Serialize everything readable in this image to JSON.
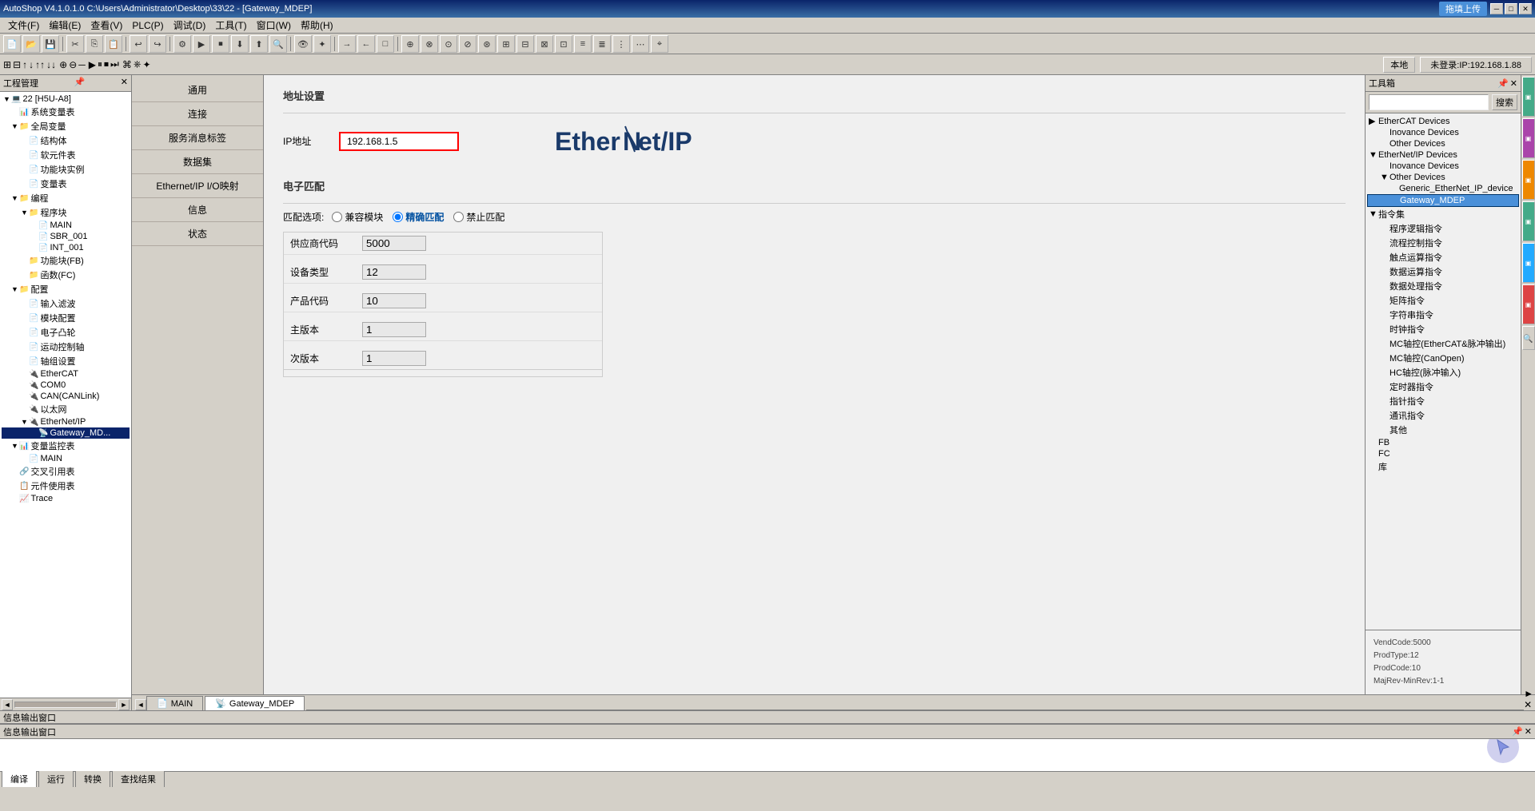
{
  "window": {
    "title": "AutoShop V4.1.0.1.0  C:\\Users\\Administrator\\Desktop\\33\\22 - [Gateway_MDEP]",
    "upload_btn": "拖填上传"
  },
  "menu": {
    "items": [
      "文件(F)",
      "编辑(E)",
      "查看(V)",
      "PLC(P)",
      "调试(D)",
      "工具(T)",
      "窗口(W)",
      "帮助(H)"
    ]
  },
  "toolbar2": {
    "location_btn": "本地",
    "ip_btn": "未登录:IP:192.168.1.88"
  },
  "project_tree": {
    "header": "工程管理",
    "items": [
      {
        "label": "22 [H5U-A8]",
        "indent": 0,
        "expanded": true
      },
      {
        "label": "系统变量表",
        "indent": 1
      },
      {
        "label": "全局变量",
        "indent": 1,
        "expanded": true
      },
      {
        "label": "结构体",
        "indent": 2
      },
      {
        "label": "软元件表",
        "indent": 2
      },
      {
        "label": "功能块实例",
        "indent": 2
      },
      {
        "label": "变量表",
        "indent": 2
      },
      {
        "label": "编程",
        "indent": 1,
        "expanded": true
      },
      {
        "label": "程序块",
        "indent": 2,
        "expanded": true
      },
      {
        "label": "MAIN",
        "indent": 3
      },
      {
        "label": "SBR_001",
        "indent": 3
      },
      {
        "label": "INT_001",
        "indent": 3
      },
      {
        "label": "功能块(FB)",
        "indent": 2
      },
      {
        "label": "函数(FC)",
        "indent": 2
      },
      {
        "label": "配置",
        "indent": 1,
        "expanded": true
      },
      {
        "label": "输入滤波",
        "indent": 2
      },
      {
        "label": "模块配置",
        "indent": 2
      },
      {
        "label": "电子凸轮",
        "indent": 2
      },
      {
        "label": "运动控制轴",
        "indent": 2
      },
      {
        "label": "轴组设置",
        "indent": 2
      },
      {
        "label": "EtherCAT",
        "indent": 2
      },
      {
        "label": "COM0",
        "indent": 2
      },
      {
        "label": "CAN(CANLink)",
        "indent": 2
      },
      {
        "label": "以太网",
        "indent": 2
      },
      {
        "label": "EtherNet/IP",
        "indent": 2,
        "expanded": true
      },
      {
        "label": "Gateway_MDEP",
        "indent": 3,
        "selected": true
      },
      {
        "label": "变量监控表",
        "indent": 1,
        "expanded": true
      },
      {
        "label": "MAIN",
        "indent": 2
      },
      {
        "label": "交叉引用表",
        "indent": 1
      },
      {
        "label": "元件使用表",
        "indent": 1
      },
      {
        "label": "Trace",
        "indent": 1
      }
    ]
  },
  "nav_sidebar": {
    "items": [
      "通用",
      "连接",
      "服务消息标签",
      "数据集",
      "Ethernet/IP I/O映射",
      "信息",
      "状态"
    ]
  },
  "main_panel": {
    "section_address": "地址设置",
    "ip_label": "IP地址",
    "ip_value": "192.168.1.5",
    "logo_text": "EtherNet/IP",
    "section_match": "电子匹配",
    "match_label": "匹配选项:",
    "radio_options": [
      "兼容模块",
      "精确匹配",
      "禁止匹配"
    ],
    "radio_selected": "精确匹配",
    "fields": [
      {
        "label": "供应商代码",
        "value": "5000"
      },
      {
        "label": "设备类型",
        "value": "12"
      },
      {
        "label": "产品代码",
        "value": "10"
      },
      {
        "label": "主版本",
        "value": "1"
      },
      {
        "label": "次版本",
        "value": "1"
      }
    ]
  },
  "toolbox": {
    "header": "工具箱",
    "search_placeholder": "",
    "search_btn": "搜索",
    "tree": [
      {
        "label": "EtherCAT Devices",
        "indent": 0,
        "expanded": true
      },
      {
        "label": "Inovance Devices",
        "indent": 1
      },
      {
        "label": "Other Devices",
        "indent": 1
      },
      {
        "label": "EtherNet/IP Devices",
        "indent": 0,
        "expanded": true
      },
      {
        "label": "Inovance Devices",
        "indent": 1
      },
      {
        "label": "Other Devices",
        "indent": 1,
        "expanded": true
      },
      {
        "label": "Generic_EtherNet_IP_device",
        "indent": 2
      },
      {
        "label": "Gateway_MDEP",
        "indent": 2,
        "highlighted": true
      },
      {
        "label": "指令集",
        "indent": 0,
        "expanded": true
      },
      {
        "label": "程序逻辑指令",
        "indent": 1
      },
      {
        "label": "流程控制指令",
        "indent": 1
      },
      {
        "label": "触点运算指令",
        "indent": 1
      },
      {
        "label": "数据运算指令",
        "indent": 1
      },
      {
        "label": "数据处理指令",
        "indent": 1
      },
      {
        "label": "矩阵指令",
        "indent": 1
      },
      {
        "label": "字符串指令",
        "indent": 1
      },
      {
        "label": "时钟指令",
        "indent": 1
      },
      {
        "label": "MC轴控(EtherCAT&脉冲输出)",
        "indent": 1
      },
      {
        "label": "MC轴控(CanOpen)",
        "indent": 1
      },
      {
        "label": "HC轴控(脉冲输入)",
        "indent": 1
      },
      {
        "label": "定时器指令",
        "indent": 1
      },
      {
        "label": "指针指令",
        "indent": 1
      },
      {
        "label": "通讯指令",
        "indent": 1
      },
      {
        "label": "其他",
        "indent": 1
      },
      {
        "label": "FB",
        "indent": 0
      },
      {
        "label": "FC",
        "indent": 0
      },
      {
        "label": "库",
        "indent": 0
      }
    ],
    "bottom_info": "VendCode:5000\nProdType:12\nProdCode:10\nMajRev-MinRev:1-1"
  },
  "content_tabs": {
    "tabs": [
      "MAIN",
      "Gateway_MDEP"
    ],
    "active": "Gateway_MDEP",
    "scroll_btns": [
      "◄",
      "►",
      "✕"
    ]
  },
  "status_bar": {
    "text": "信息输出窗口"
  },
  "info_output": {
    "header": "信息输出窗口",
    "tabs": [
      "编译",
      "运行",
      "转换",
      "查找结果"
    ]
  }
}
